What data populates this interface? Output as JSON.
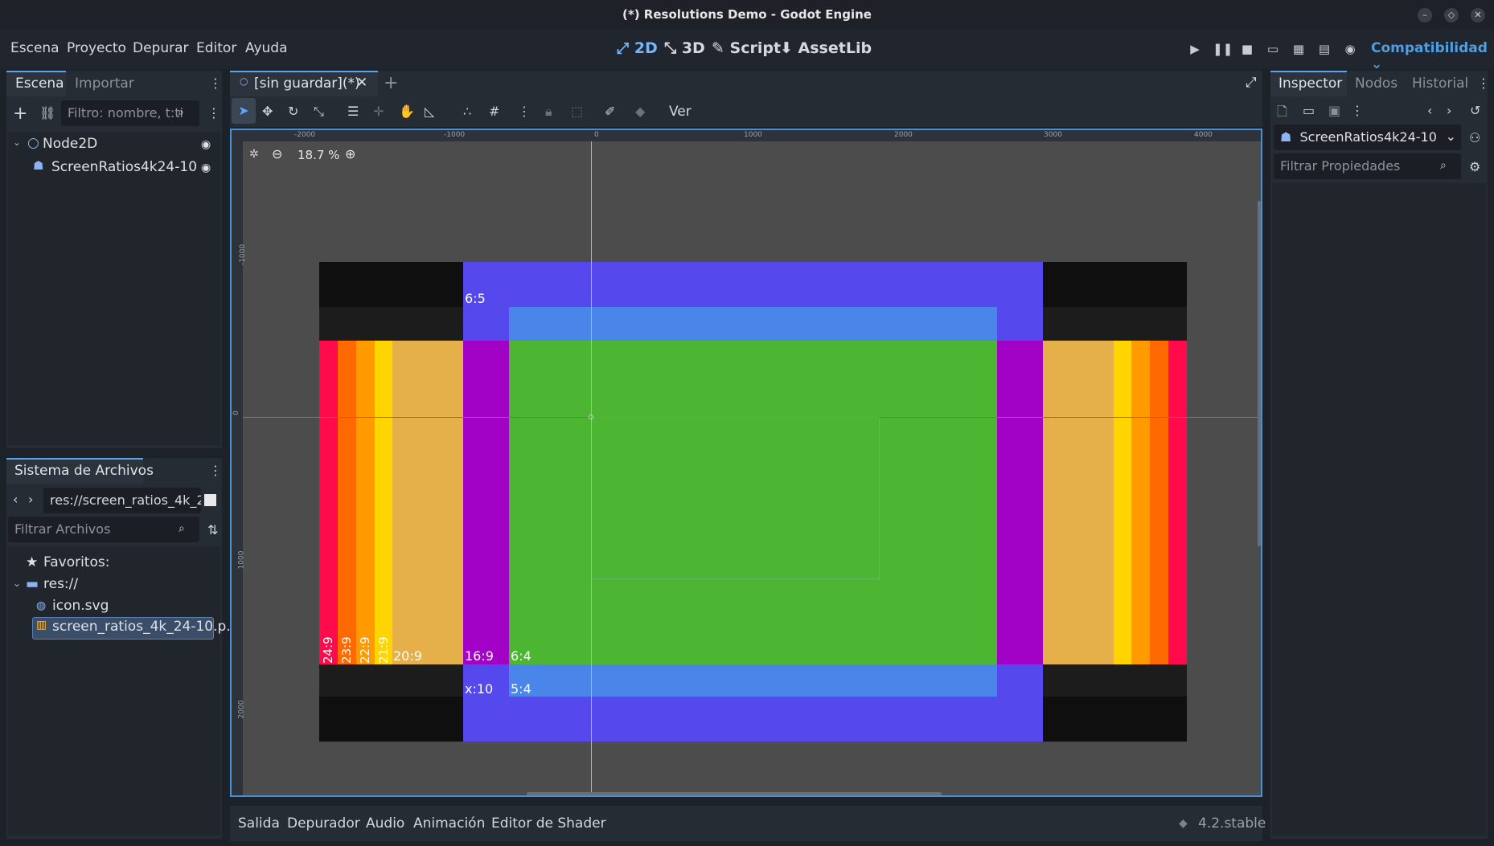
{
  "window": {
    "title": "(*) Resolutions Demo - Godot Engine"
  },
  "menu": {
    "items": [
      "Escena",
      "Proyecto",
      "Depurar",
      "Editor",
      "Ayuda"
    ]
  },
  "workspaces": {
    "w2d": "2D",
    "w3d": "3D",
    "script": "Script",
    "assetlib": "AssetLib"
  },
  "renderer": "Compatibilidad",
  "scene_dock": {
    "tab_scene": "Escena",
    "tab_import": "Importar",
    "filter_placeholder": "Filtro: nombre, t:ti",
    "nodes": [
      "Node2D",
      "ScreenRatios4k24-10"
    ]
  },
  "fs_dock": {
    "title": "Sistema de Archivos",
    "path": "res://screen_ratios_4k_2",
    "filter_placeholder": "Filtrar Archivos",
    "favorites": "Favoritos:",
    "root": "res://",
    "files": [
      "icon.svg",
      "screen_ratios_4k_24-10.p..."
    ]
  },
  "editor_tab": {
    "label": "[sin guardar](*)"
  },
  "toolbar": {
    "view_label": "Ver",
    "zoom": "18.7 %"
  },
  "rulers": {
    "h": [
      "-2000",
      "-1000",
      "0",
      "1000",
      "2000",
      "3000",
      "4000"
    ],
    "v": [
      "-1000",
      "0",
      "1000",
      "2000"
    ]
  },
  "canvas_labels": {
    "r65": "6:5",
    "r169": "16:9",
    "r64": "6:4",
    "rx10": "x:10",
    "r54": "5:4",
    "r209": "20:9",
    "r249": "24:9",
    "r239": "23:9",
    "r229": "22:9",
    "r219": "21:9"
  },
  "colors": {
    "black": "#0f0f0f",
    "dark": "#1c1c1c",
    "indigo": "#5548ec",
    "sky": "#4a86ea",
    "green": "#4cb531",
    "purple": "#a202c6",
    "sand": "#e5b04a",
    "yellow": "#ffd400",
    "orange": "#ff9a00",
    "orange2": "#ff6a00",
    "red": "#ff0a4b"
  },
  "inspector": {
    "tab_inspector": "Inspector",
    "tab_nodes": "Nodos",
    "tab_history": "Historial",
    "object": "ScreenRatios4k24-10",
    "filter_placeholder": "Filtrar Propiedades"
  },
  "bottom": {
    "tabs": [
      "Salida",
      "Depurador",
      "Audio",
      "Animación",
      "Editor de Shader"
    ],
    "version": "4.2.stable"
  }
}
